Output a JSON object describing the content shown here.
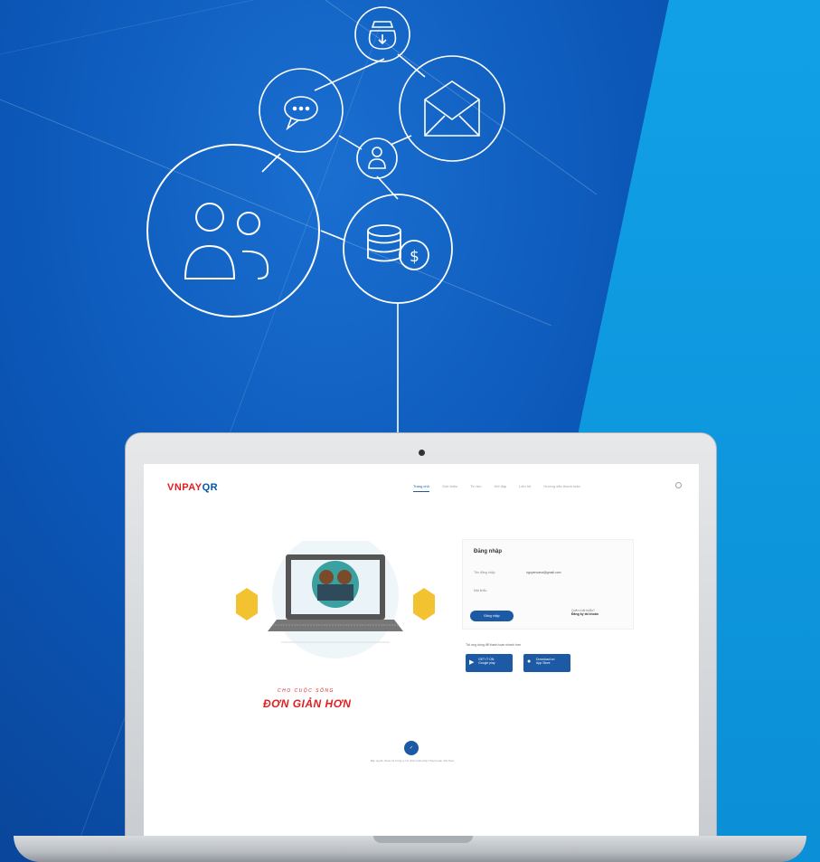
{
  "colors": {
    "accent": "#1d5aa6",
    "brand_red": "#e02020",
    "bg_dark_blue": "#0b57b8",
    "bg_light_blue": "#0b8fd6"
  },
  "network_icons": [
    "money-bag-icon",
    "chat-bubble-icon",
    "envelope-icon",
    "user-icon",
    "users-icon",
    "coins-dollar-icon"
  ],
  "screen": {
    "logo_main": "VNPAY",
    "logo_qr": "QR",
    "nav": [
      {
        "label": "Trang chủ"
      },
      {
        "label": "Giới thiệu"
      },
      {
        "label": "Tin tức"
      },
      {
        "label": "Hỏi đáp"
      },
      {
        "label": "Liên hệ"
      },
      {
        "label": "Hướng dẫn thanh toán"
      }
    ],
    "illustration_icon": "laptop-people-illustration",
    "tagline_small": "CHO CUỘC SỐNG",
    "tagline_big": "ĐƠN GIẢN HƠN",
    "login": {
      "title": "Đăng nhập",
      "username_label": "Tên đăng nhập",
      "username_value": "nguyenvana@gmail.com",
      "password_label": "Mật khẩu",
      "button": "Đăng nhập",
      "forgot_label": "Quên mật khẩu?",
      "forgot_link": "Đăng ký tài khoản"
    },
    "app_text": "Tải ứng dụng để thanh toán nhanh hơn",
    "store_buttons": [
      {
        "line1": "GET IT ON",
        "line2": "Google play",
        "icon": "play-store-icon"
      },
      {
        "line1": "Download on",
        "line2": "App Store",
        "icon": "apple-icon"
      }
    ],
    "footer_logo_icon": "vnpay-round-logo-icon",
    "footer_text": "Bản quyền thuộc về Công ty Cổ phần Giải pháp Thanh toán Việt Nam"
  }
}
